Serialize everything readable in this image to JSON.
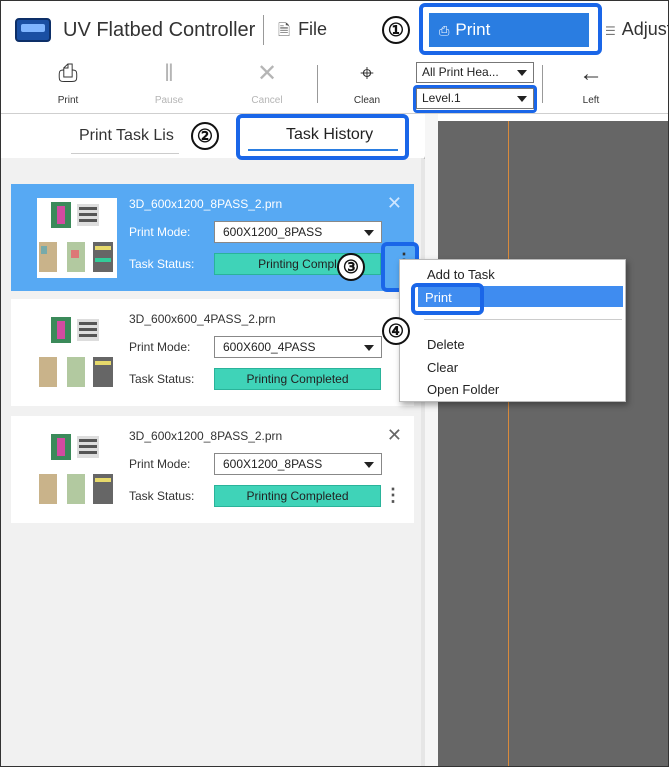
{
  "app": {
    "title": "UV Flatbed Controller"
  },
  "menu": {
    "file": "File",
    "print": "Print",
    "adjust": "Adjust"
  },
  "callouts": {
    "c1": "①",
    "c2": "②",
    "c3": "③",
    "c4": "④"
  },
  "toolbar": {
    "buttons": [
      {
        "label": "Print",
        "icon": "printer-icon"
      },
      {
        "label": "Pause",
        "icon": "pause-icon"
      },
      {
        "label": "Cancel",
        "icon": "close-icon"
      },
      {
        "label": "Clean",
        "icon": "brush-icon"
      },
      {
        "label": "Left",
        "icon": "arrow-left-icon"
      }
    ],
    "head_select": "All Print Hea...",
    "level_select": "Level.1"
  },
  "tabs": {
    "print_task_list": "Print Task Lis",
    "task_history": "Task History"
  },
  "labels": {
    "print_mode": "Print Mode:",
    "task_status": "Task Status:"
  },
  "tasks": [
    {
      "file": "3D_600x1200_8PASS_2.prn",
      "mode": "600X1200_8PASS",
      "status": "Printing Compl"
    },
    {
      "file": "3D_600x600_4PASS_2.prn",
      "mode": "600X600_4PASS",
      "status": "Printing Completed"
    },
    {
      "file": "3D_600x1200_8PASS_2.prn",
      "mode": "600X1200_8PASS",
      "status": "Printing Completed"
    }
  ],
  "context_menu": {
    "items": [
      "Add to Task",
      "Print",
      "Delete",
      "Clear",
      "Open Folder"
    ]
  },
  "colors": {
    "accent": "#2a7de1",
    "highlight_border": "#1a66e8",
    "status_green": "#3fd3b8",
    "selected_card": "#57a9f3",
    "canvas": "#666666"
  }
}
